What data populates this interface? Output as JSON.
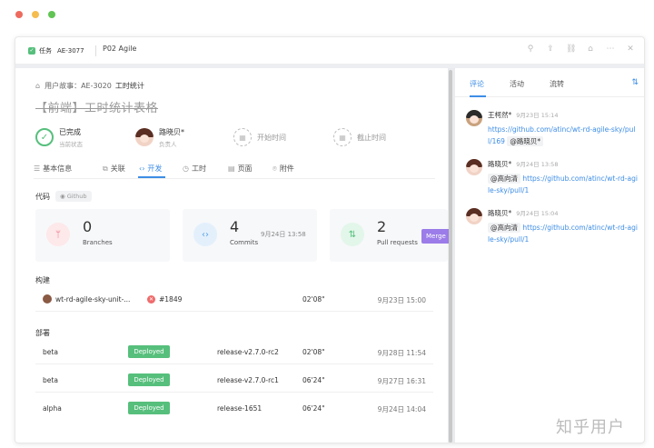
{
  "header": {
    "type_label": "任务",
    "key": "AE-3077",
    "project": "P02 Agile"
  },
  "breadcrumb": {
    "parent_type": "用户故事：",
    "parent_key": "AE-3020",
    "parent_title": "工时统计"
  },
  "title": "【前端】工时统计表格",
  "status": {
    "state": "已完成",
    "state_label": "当前状态",
    "assignee": "路晓贝*",
    "assignee_label": "负责人",
    "start_time": "开始时间",
    "due_time": "截止时间"
  },
  "tabs": [
    {
      "label": "基本信息",
      "icon": "list-icon"
    },
    {
      "label": "关联",
      "icon": "link-icon"
    },
    {
      "label": "开发",
      "icon": "code-icon"
    },
    {
      "label": "工时",
      "icon": "clock-icon"
    },
    {
      "label": "页面",
      "icon": "page-icon"
    },
    {
      "label": "附件",
      "icon": "attachment-icon"
    }
  ],
  "active_tab": "开发",
  "code": {
    "label": "代码",
    "repo": "Github"
  },
  "cards": [
    {
      "count": "0",
      "label": "Branches",
      "date": ""
    },
    {
      "count": "4",
      "label": "Commits",
      "date": "9月24日 13:58"
    },
    {
      "count": "2",
      "label": "Pull requests",
      "date": ""
    }
  ],
  "merge_label": "Merge",
  "build": {
    "label": "构建",
    "rows": [
      {
        "name": "wt-rd-agile-sky-unit-...",
        "number": "#1849",
        "duration": "02'08\"",
        "date": "9月23日 15:00"
      }
    ]
  },
  "deploy": {
    "label": "部署",
    "rows": [
      {
        "env": "beta",
        "status": "Deployed",
        "release": "release-v2.7.0-rc2",
        "duration": "02'08\"",
        "date": "9月28日 11:54"
      },
      {
        "env": "beta",
        "status": "Deployed",
        "release": "release-v2.7.0-rc1",
        "duration": "06'24\"",
        "date": "9月27日 16:31"
      },
      {
        "env": "alpha",
        "status": "Deployed",
        "release": "release-1651",
        "duration": "06'24\"",
        "date": "9月24日 14:04"
      }
    ]
  },
  "right_panel": {
    "tabs": [
      "评论",
      "活动",
      "流转"
    ],
    "active_tab": "评论",
    "sort_icon": "sort-icon",
    "comments": [
      {
        "author": "王柯然*",
        "time": "9月23日 15:14",
        "link": "https://github.com/atinc/wt-rd-agile-sky/pull/169",
        "mention": "@路晓贝*"
      },
      {
        "author": "路晓贝*",
        "time": "9月24日 13:58",
        "mention": "@高向清",
        "link": "https://github.com/atinc/wt-rd-agile-sky/pull/1"
      },
      {
        "author": "路晓贝*",
        "time": "9月24日 15:04",
        "mention": "@高向清",
        "link": "https://github.com/atinc/wt-rd-agile-sky/pull/1"
      }
    ]
  },
  "watermark": "知乎用户",
  "colors": {
    "accent": "#3d8de6",
    "success": "#56bf7c",
    "merge": "#9b7ce8",
    "fail": "#ef6b6b"
  }
}
